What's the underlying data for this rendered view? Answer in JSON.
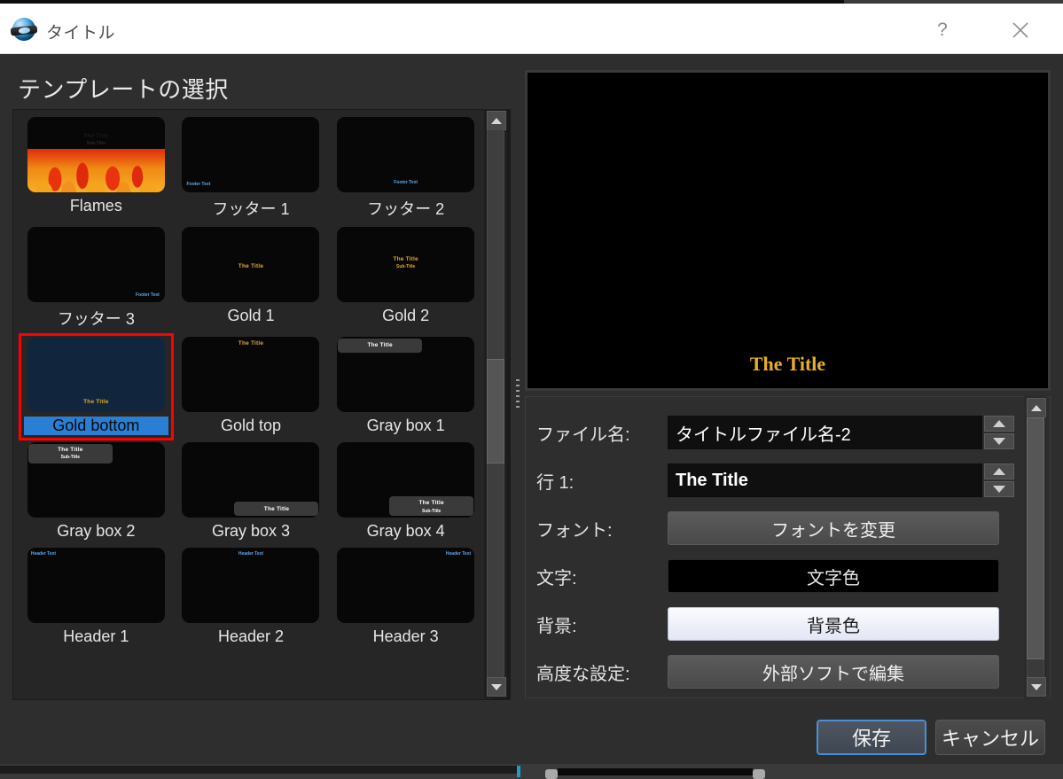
{
  "window": {
    "title": "タイトル",
    "icon": "openshot-sphere-icon",
    "help_label": "?",
    "close_label": "close-icon"
  },
  "section": {
    "heading": "テンプレートの選択"
  },
  "templates": [
    {
      "name": "Flames",
      "style": "flames",
      "title": "The Title",
      "subtitle": "Sub-Title",
      "selected": false
    },
    {
      "name": "フッター 1",
      "style": "footer-left",
      "footer": "Footer Text",
      "selected": false
    },
    {
      "name": "フッター 2",
      "style": "footer-center",
      "footer": "Footer Text",
      "selected": false
    },
    {
      "name": "フッター 3",
      "style": "footer-right",
      "footer": "Footer Text",
      "selected": false
    },
    {
      "name": "Gold 1",
      "style": "gold-center",
      "title": "The Title",
      "selected": false
    },
    {
      "name": "Gold 2",
      "style": "gold-center-2",
      "title": "The Title",
      "subtitle": "Sub-Title",
      "selected": false
    },
    {
      "name": "Gold bottom",
      "style": "gold-bottom",
      "title": "The Title",
      "selected": true
    },
    {
      "name": "Gold top",
      "style": "gold-top",
      "title": "The Title",
      "selected": false
    },
    {
      "name": "Gray box 1",
      "style": "graybox-tl",
      "title": "The Title",
      "selected": false
    },
    {
      "name": "Gray box 2",
      "style": "graybox-tl2",
      "title": "The Title",
      "subtitle": "Sub-Title",
      "selected": false
    },
    {
      "name": "Gray box 3",
      "style": "graybox-br",
      "title": "The Title",
      "selected": false
    },
    {
      "name": "Gray box 4",
      "style": "graybox-br2",
      "title": "The Title",
      "subtitle": "Sub-Title",
      "selected": false
    },
    {
      "name": "Header 1",
      "style": "header-left",
      "header": "Header Text",
      "selected": false
    },
    {
      "name": "Header 2",
      "style": "header-center",
      "header": "Header Text",
      "selected": false
    },
    {
      "name": "Header 3",
      "style": "header-right",
      "header": "Header Text",
      "selected": false
    }
  ],
  "preview": {
    "title_text": "The Title",
    "background_color": "#000000",
    "title_color": "#e8ae2c"
  },
  "form": {
    "filename": {
      "label": "ファイル名:",
      "value": "タイトルファイル名-2"
    },
    "line1": {
      "label": "行 1:",
      "value": "The Title"
    },
    "font": {
      "label": "フォント:",
      "button": "フォントを変更"
    },
    "text": {
      "label": "文字:",
      "button": "文字色",
      "swatch": "#000000"
    },
    "background": {
      "label": "背景:",
      "button": "背景色",
      "swatch": "#eef0fa"
    },
    "advanced": {
      "label": "高度な設定:",
      "button": "外部ソフトで編集"
    }
  },
  "footer": {
    "save_label": "保存",
    "cancel_label": "キャンセル"
  },
  "scrollbars": {
    "up_arrow": "chevron-up-icon",
    "down_arrow": "chevron-down-icon"
  }
}
